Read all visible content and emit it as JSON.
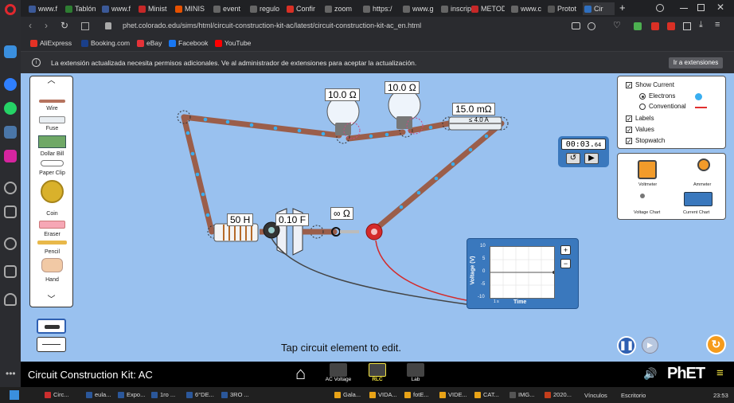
{
  "browser": {
    "tabs": [
      {
        "label": "www.f",
        "color": "#3b5998"
      },
      {
        "label": "Tablón",
        "color": "#2e7d32"
      },
      {
        "label": "www.f",
        "color": "#3b5998"
      },
      {
        "label": "Minist",
        "color": "#c62828"
      },
      {
        "label": "MINIS",
        "color": "#e65100"
      },
      {
        "label": "event",
        "color": "#666666"
      },
      {
        "label": "regulo",
        "color": "#666666"
      },
      {
        "label": "Confir",
        "color": "#d93025"
      },
      {
        "label": "zoom",
        "color": "#666666"
      },
      {
        "label": "https:/",
        "color": "#666666"
      },
      {
        "label": "www.g",
        "color": "#666666"
      },
      {
        "label": "inscrip",
        "color": "#666666"
      },
      {
        "label": "METOD",
        "color": "#c62828"
      },
      {
        "label": "www.c",
        "color": "#666666"
      },
      {
        "label": "Protot",
        "color": "#555555"
      },
      {
        "label": "Cir",
        "color": "#2f6fbf"
      }
    ],
    "new_tab": "+",
    "url": "phet.colorado.edu/sims/html/circuit-construction-kit-ac/latest/circuit-construction-kit-ac_en.html",
    "bookmarks": [
      {
        "label": "AliExpress",
        "color": "#e43225"
      },
      {
        "label": "Booking.com",
        "color": "#1a3f8a"
      },
      {
        "label": "eBay",
        "color": "#e53238"
      },
      {
        "label": "Facebook",
        "color": "#1877f2"
      },
      {
        "label": "YouTube",
        "color": "#ff0000"
      }
    ],
    "infobar": {
      "message": "La extensión actualizada necesita permisos adicionales. Ve al administrador de extensiones para aceptar la actualización.",
      "button": "Ir a extensiones"
    }
  },
  "toolbox": {
    "items": [
      {
        "label": "Wire"
      },
      {
        "label": "Fuse"
      },
      {
        "label": "Dollar Bill"
      },
      {
        "label": "Paper Clip"
      },
      {
        "label": "Coin"
      },
      {
        "label": "Eraser"
      },
      {
        "label": "Pencil"
      },
      {
        "label": "Hand"
      }
    ]
  },
  "circuit": {
    "bulb1_label": "10.0 Ω",
    "bulb2_label": "10.0 Ω",
    "fuse_label": "15.0 mΩ",
    "fuse_rating": "≤ 4.0 A",
    "inductor_label": "50 H",
    "capacitor_label": "0.10 F",
    "switch_label": "∞ Ω"
  },
  "options": {
    "show_current": "Show Current",
    "electrons": "Electrons",
    "conventional": "Conventional",
    "labels": "Labels",
    "values": "Values",
    "stopwatch": "Stopwatch",
    "checked": "✓"
  },
  "stopwatch": {
    "time": "00:03.",
    "hundredths": "64",
    "reset": "↺",
    "play": "▶"
  },
  "sensors": {
    "voltmeter": "Voltmeter",
    "ammeter": "Ammeter",
    "voltage_chart": "Voltage Chart",
    "current_chart": "Current Chart"
  },
  "voltage_chart": {
    "ylabel": "Voltage (V)",
    "xlabel": "Time",
    "scale": "1 s",
    "ticks": [
      "10",
      "5",
      "0",
      "-5",
      "-10"
    ],
    "zoom_in": "+",
    "zoom_out": "−"
  },
  "messages": {
    "tap": "Tap circuit element to edit."
  },
  "controls": {
    "pause": "❚❚",
    "step": "▶",
    "reset": "↻"
  },
  "nav": {
    "title": "Circuit Construction Kit: AC",
    "home": "⌂",
    "screens": [
      {
        "label": "AC Voltage",
        "selected": false
      },
      {
        "label": "RLC",
        "selected": true
      },
      {
        "label": "Lab",
        "selected": false
      }
    ],
    "brand": "PhET",
    "sound": "🔊",
    "menu": "≡"
  },
  "taskbar": {
    "items": [
      {
        "label": "Circ...",
        "color": "#cc2e2e"
      },
      {
        "label": "eula...",
        "color": "#2b579a"
      },
      {
        "label": "Expo...",
        "color": "#2b579a"
      },
      {
        "label": "1ro ...",
        "color": "#2b579a"
      },
      {
        "label": "6°DE...",
        "color": "#2b579a"
      },
      {
        "label": "3RO ...",
        "color": "#2b579a"
      },
      {
        "label": "Gala...",
        "color": "#e8a317"
      },
      {
        "label": "VIDA...",
        "color": "#e8a317"
      },
      {
        "label": "fotE...",
        "color": "#e8a317"
      },
      {
        "label": "VIDE...",
        "color": "#e8a317"
      },
      {
        "label": "CAT...",
        "color": "#e8a317"
      },
      {
        "label": "IMG...",
        "color": "#555555"
      },
      {
        "label": "2020...",
        "color": "#c43e1c"
      }
    ],
    "vinculos": "Vínculos",
    "escritorio": "Escritorio",
    "clock": "23:53"
  }
}
